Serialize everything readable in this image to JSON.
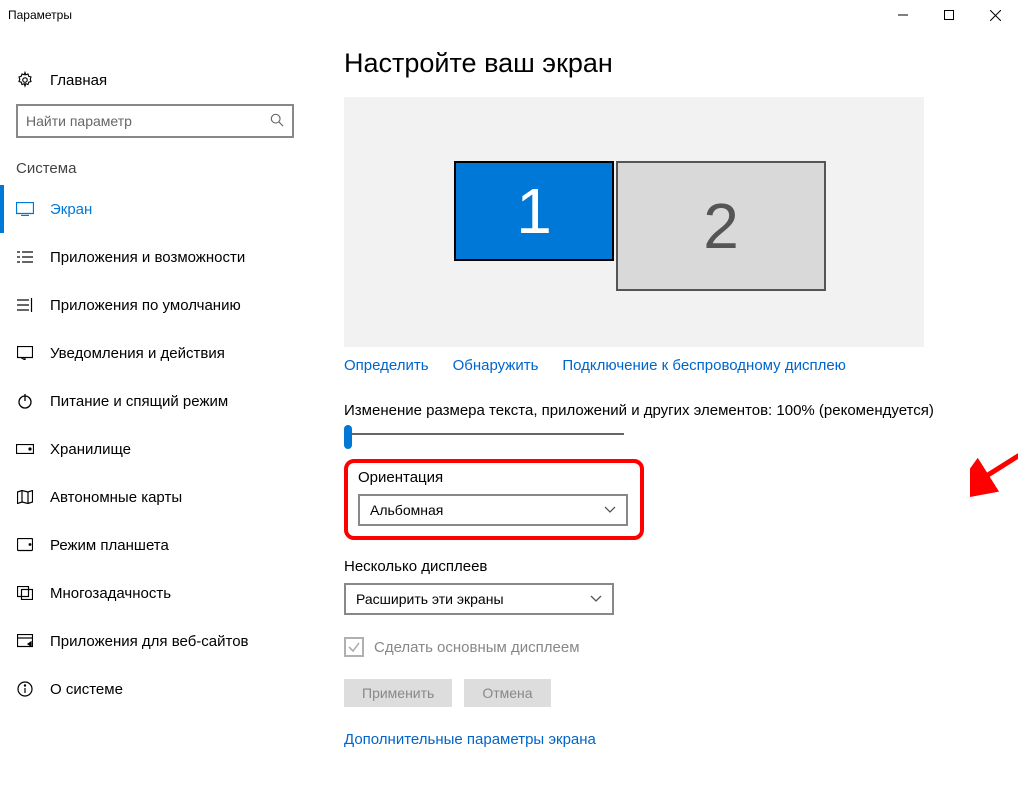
{
  "window": {
    "title": "Параметры"
  },
  "sidebar": {
    "home": "Главная",
    "search_placeholder": "Найти параметр",
    "section": "Система",
    "items": [
      {
        "label": "Экран"
      },
      {
        "label": "Приложения и возможности"
      },
      {
        "label": "Приложения по умолчанию"
      },
      {
        "label": "Уведомления и действия"
      },
      {
        "label": "Питание и спящий режим"
      },
      {
        "label": "Хранилище"
      },
      {
        "label": "Автономные карты"
      },
      {
        "label": "Режим планшета"
      },
      {
        "label": "Многозадачность"
      },
      {
        "label": "Приложения для веб-сайтов"
      },
      {
        "label": "О системе"
      }
    ]
  },
  "main": {
    "heading": "Настройте ваш экран",
    "displays": {
      "one": "1",
      "two": "2"
    },
    "links": {
      "identify": "Определить",
      "detect": "Обнаружить",
      "wireless": "Подключение к беспроводному дисплею"
    },
    "scaling_label": "Изменение размера текста, приложений и других элементов: 100% (рекомендуется)",
    "orientation_label": "Ориентация",
    "orientation_value": "Альбомная",
    "multi_label": "Несколько дисплеев",
    "multi_value": "Расширить эти экраны",
    "primary_checkbox": "Сделать основным дисплеем",
    "apply": "Применить",
    "cancel": "Отмена",
    "advanced": "Дополнительные параметры экрана"
  }
}
